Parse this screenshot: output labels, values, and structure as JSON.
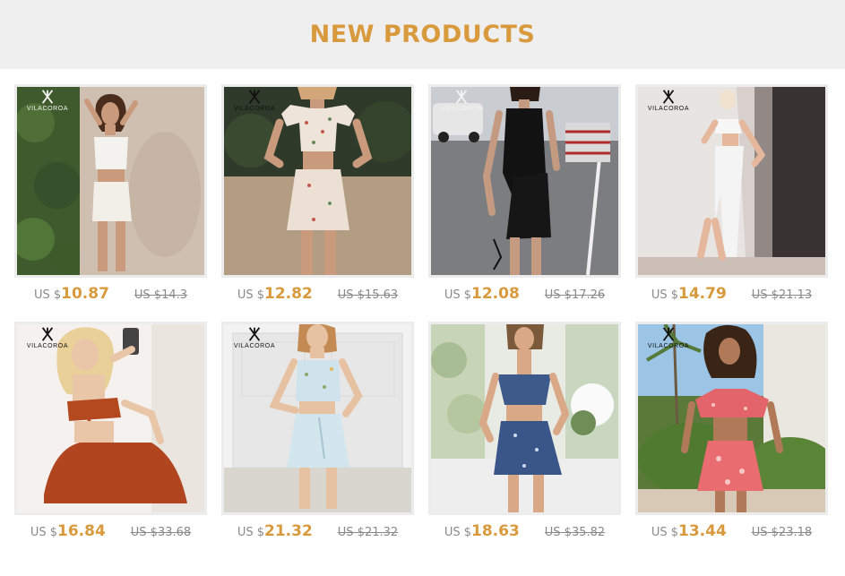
{
  "header": {
    "title": "NEW PRODUCTS"
  },
  "brand_logo_text": "VILACOROA",
  "colors": {
    "accent": "#d99a3e",
    "header_bg": "#efefef",
    "muted": "#8a8a8a"
  },
  "products": [
    {
      "currency": "US $",
      "price": "10.87",
      "old_price": "US $14.3",
      "logo_light": true
    },
    {
      "currency": "US $",
      "price": "12.82",
      "old_price": "US $15.63",
      "logo_light": false
    },
    {
      "currency": "US $",
      "price": "12.08",
      "old_price": "US $17.26",
      "logo_light": true
    },
    {
      "currency": "US $",
      "price": "14.79",
      "old_price": "US $21.13",
      "logo_light": false
    },
    {
      "currency": "US $",
      "price": "16.84",
      "old_price": "US $33.68",
      "logo_light": false
    },
    {
      "currency": "US $",
      "price": "21.32",
      "old_price": "US $21.32",
      "logo_light": false
    },
    {
      "currency": "US $",
      "price": "18.63",
      "old_price": "US $35.82",
      "logo_light": false
    },
    {
      "currency": "US $",
      "price": "13.44",
      "old_price": "US $23.18",
      "logo_light": false
    }
  ]
}
